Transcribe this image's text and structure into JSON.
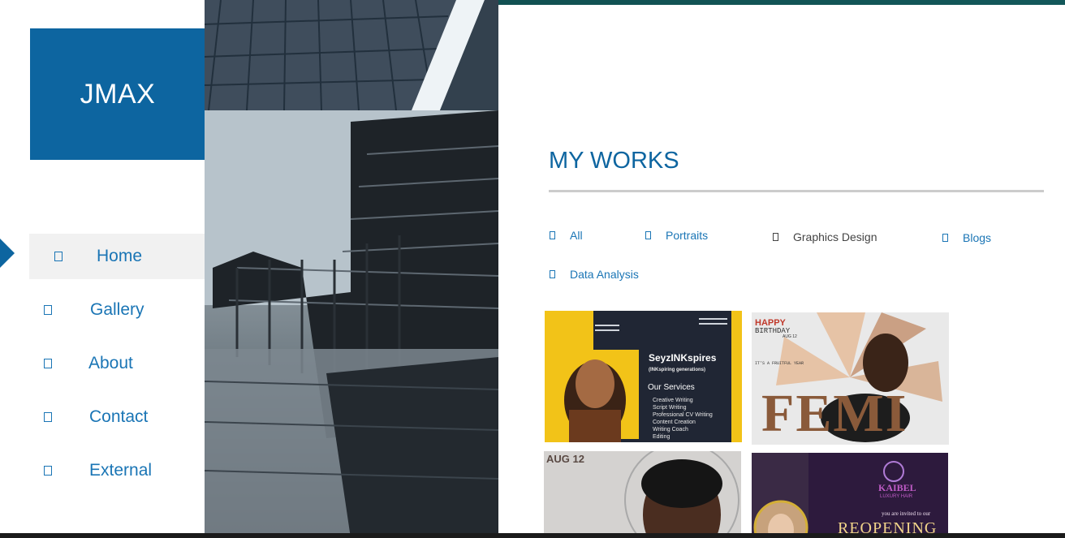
{
  "brand": {
    "name": "JMAX"
  },
  "nav": {
    "items": [
      {
        "label": "Home",
        "icon": "home-icon",
        "active": true
      },
      {
        "label": "Gallery",
        "icon": "gallery-icon"
      },
      {
        "label": "About",
        "icon": "about-icon"
      },
      {
        "label": "Contact",
        "icon": "contact-icon"
      },
      {
        "label": "External",
        "icon": "external-icon"
      }
    ]
  },
  "main": {
    "title": "MY WORKS",
    "filters": [
      {
        "label": "All"
      },
      {
        "label": "Portraits"
      },
      {
        "label": "Graphics Design"
      },
      {
        "label": "Blogs"
      },
      {
        "label": "Data Analysis"
      }
    ],
    "gallery": {
      "tile1": {
        "heading": "SeyzINKspires",
        "subheading": "(INKspiring generations)",
        "services_title": "Our Services",
        "services": [
          "Creative Writing",
          "Script Writing",
          "Professional CV Writing",
          "Content Creation",
          "Writing Coach",
          "Editing"
        ]
      },
      "tile2": {
        "happy": "HAPPY",
        "birthday": "BIRTHDAY",
        "date": "AUG 12",
        "tagline": "IT'S A FRUITFUL YEAR",
        "name": "FEMI"
      },
      "tile3": {
        "date": "AUG 12"
      },
      "tile4": {
        "brand": "KAIBEL",
        "sub": "LUXURY HAIR",
        "invite": "you are invited to our",
        "event": "REOPENING"
      }
    }
  },
  "colors": {
    "brand_blue": "#0d65a0",
    "link_blue": "#1a75b5",
    "top_strip": "#0f4a4a"
  }
}
